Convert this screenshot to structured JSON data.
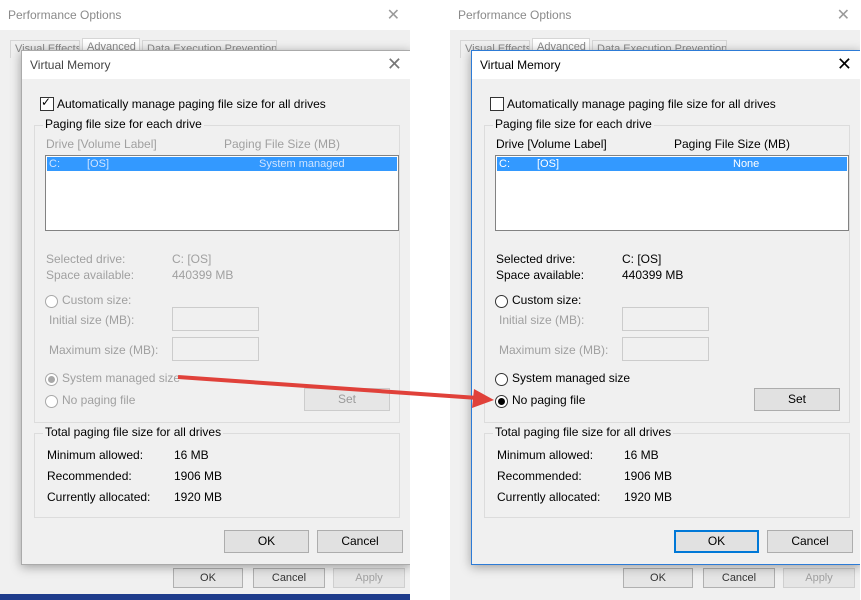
{
  "left_panel": {
    "perf_title": "Performance Options",
    "tabs": [
      "Visual Effects",
      "Advanced",
      "Data Execution Prevention"
    ],
    "perf_buttons": {
      "ok": "OK",
      "cancel": "Cancel",
      "apply": "Apply"
    },
    "vm": {
      "title": "Virtual Memory",
      "auto_manage_label": "Automatically manage paging file size for all drives",
      "auto_manage_checked": true,
      "group_paging": "Paging file size for each drive",
      "col_drive": "Drive  [Volume Label]",
      "col_size": "Paging File Size (MB)",
      "drive_letter": "C:",
      "drive_label": "[OS]",
      "drive_size": "System managed",
      "selected_drive_label": "Selected drive:",
      "selected_drive_value": "C:  [OS]",
      "space_label": "Space available:",
      "space_value": "440399 MB",
      "custom_size": "Custom size:",
      "initial_size": "Initial size (MB):",
      "maximum_size": "Maximum size (MB):",
      "system_managed": "System managed size",
      "no_paging": "No paging file",
      "set": "Set",
      "group_total": "Total paging file size for all drives",
      "min_label": "Minimum allowed:",
      "min_value": "16 MB",
      "rec_label": "Recommended:",
      "rec_value": "1906 MB",
      "cur_label": "Currently allocated:",
      "cur_value": "1920 MB",
      "ok": "OK",
      "cancel": "Cancel"
    }
  },
  "right_panel": {
    "perf_title": "Performance Options",
    "tabs": [
      "Visual Effects",
      "Advanced",
      "Data Execution Prevention"
    ],
    "perf_buttons": {
      "ok": "OK",
      "cancel": "Cancel",
      "apply": "Apply"
    },
    "vm": {
      "title": "Virtual Memory",
      "auto_manage_label": "Automatically manage paging file size for all drives",
      "auto_manage_checked": false,
      "group_paging": "Paging file size for each drive",
      "col_drive": "Drive  [Volume Label]",
      "col_size": "Paging File Size (MB)",
      "drive_letter": "C:",
      "drive_label": "[OS]",
      "drive_size": "None",
      "selected_drive_label": "Selected drive:",
      "selected_drive_value": "C:  [OS]",
      "space_label": "Space available:",
      "space_value": "440399 MB",
      "custom_size": "Custom size:",
      "initial_size": "Initial size (MB):",
      "maximum_size": "Maximum size (MB):",
      "system_managed": "System managed size",
      "no_paging": "No paging file",
      "set": "Set",
      "group_total": "Total paging file size for all drives",
      "min_label": "Minimum allowed:",
      "min_value": "16 MB",
      "rec_label": "Recommended:",
      "rec_value": "1906 MB",
      "cur_label": "Currently allocated:",
      "cur_value": "1920 MB",
      "ok": "OK",
      "cancel": "Cancel"
    }
  },
  "annotation": {
    "arrow_color": "#e0413a"
  }
}
